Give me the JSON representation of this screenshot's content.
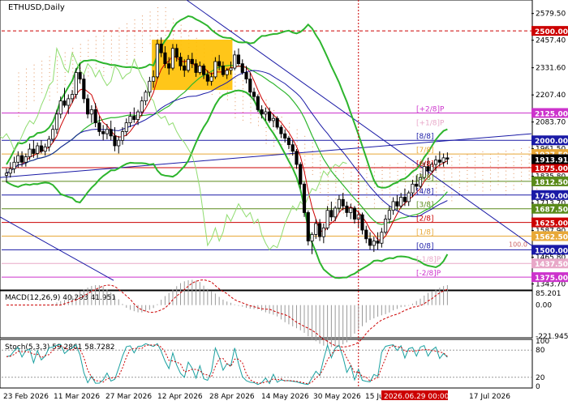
{
  "chart_data": {
    "type": "candlestick",
    "symbol": "ETHUSD",
    "timeframe": "Daily",
    "title": "ETHUSD,Daily",
    "y_ticks": [
      "2579.50",
      "2457.40",
      "2331.60",
      "2207.40",
      "2083.70",
      "1961.50",
      "1835.80",
      "1713.70",
      "1587.90",
      "1465.80",
      "1343.70"
    ],
    "x_ticks": [
      "23 Feb 2026",
      "11 Mar 2026",
      "27 Mar 2026",
      "12 Apr 2026",
      "28 Apr 2026",
      "14 May 2026",
      "30 May 2026",
      "15 Jun 2026",
      "2026.06.29 00:00",
      "17 Jul 2026"
    ],
    "cursor_label": "2026.06.29 00:00",
    "current_price": "1913.91",
    "hidden_price": "1937.50",
    "price_levels": [
      {
        "value": 2500.0,
        "label": "2500.00",
        "color": "#cc0000"
      },
      {
        "value": 2125.0,
        "label": "2125.00",
        "color": "#cc33cc"
      },
      {
        "value": 2000.0,
        "label": "2000.00",
        "color": "#1a1aa6"
      },
      {
        "value": 1937.5,
        "label": "1937.50",
        "color": "#e8a838"
      },
      {
        "value": 1875.0,
        "label": "1875.00",
        "color": "#cc0000"
      },
      {
        "value": 1812.5,
        "label": "1812.50",
        "color": "#5a8a1a"
      },
      {
        "value": 1750.0,
        "label": "1750.00",
        "color": "#1a1aa6"
      },
      {
        "value": 1687.5,
        "label": "1687.50",
        "color": "#5a8a1a"
      },
      {
        "value": 1625.0,
        "label": "1625.00",
        "color": "#cc0000"
      },
      {
        "value": 1562.5,
        "label": "1562.50",
        "color": "#e8a838"
      },
      {
        "value": 1500.0,
        "label": "1500.00",
        "color": "#1a1aa6"
      },
      {
        "value": 1437.5,
        "label": "1437.50",
        "color": "#e8a8c8"
      },
      {
        "value": 1375.0,
        "label": "1375.00",
        "color": "#cc33cc"
      }
    ],
    "murrey_labels": [
      {
        "text": "[+2/8]P",
        "value": 2125.0,
        "color": "#cc33cc"
      },
      {
        "text": "[+1/8]P",
        "value": 2062.5,
        "color": "#e8a8c8"
      },
      {
        "text": "[8/8]",
        "value": 2000.0,
        "color": "#1a1aa6"
      },
      {
        "text": "[7/8]",
        "value": 1937.5,
        "color": "#e8a838"
      },
      {
        "text": "[6/8]",
        "value": 1875.0,
        "color": "#cc0000"
      },
      {
        "text": "[5/8]",
        "value": 1812.5,
        "color": "#5a8a1a"
      },
      {
        "text": "[4/8]",
        "value": 1750.0,
        "color": "#1a1aa6"
      },
      {
        "text": "[3/8]",
        "value": 1687.5,
        "color": "#5a8a1a"
      },
      {
        "text": "[2/8]",
        "value": 1625.0,
        "color": "#cc0000"
      },
      {
        "text": "[1/8]",
        "value": 1562.5,
        "color": "#e8a838"
      },
      {
        "text": "[0/8]",
        "value": 1500.0,
        "color": "#1a1aa6"
      },
      {
        "text": "[-1/8]P",
        "value": 1437.5,
        "color": "#e8a8c8"
      },
      {
        "text": "[-2/8]P",
        "value": 1375.0,
        "color": "#cc33cc"
      }
    ],
    "percent_label": "100.0",
    "ohlc": [
      [
        1840,
        1872,
        1808,
        1850
      ],
      [
        1850,
        1900,
        1830,
        1870
      ],
      [
        1870,
        1925,
        1850,
        1900
      ],
      [
        1900,
        1950,
        1875,
        1930
      ],
      [
        1930,
        1950,
        1880,
        1900
      ],
      [
        1900,
        1940,
        1880,
        1925
      ],
      [
        1925,
        1985,
        1910,
        1960
      ],
      [
        1960,
        2000,
        1920,
        1940
      ],
      [
        1940,
        1990,
        1920,
        1975
      ],
      [
        1975,
        2000,
        1940,
        1950
      ],
      [
        1950,
        1985,
        1930,
        1970
      ],
      [
        1970,
        2020,
        1950,
        2005
      ],
      [
        2005,
        2070,
        1990,
        2050
      ],
      [
        2050,
        2140,
        2030,
        2120
      ],
      [
        2120,
        2200,
        2100,
        2180
      ],
      [
        2180,
        2240,
        2150,
        2160
      ],
      [
        2160,
        2210,
        2120,
        2190
      ],
      [
        2190,
        2230,
        2170,
        2210
      ],
      [
        2210,
        2330,
        2190,
        2310
      ],
      [
        2310,
        2350,
        2260,
        2280
      ],
      [
        2280,
        2300,
        2170,
        2190
      ],
      [
        2190,
        2210,
        2100,
        2120
      ],
      [
        2120,
        2160,
        2080,
        2140
      ],
      [
        2140,
        2170,
        2060,
        2080
      ],
      [
        2080,
        2110,
        2020,
        2040
      ],
      [
        2040,
        2070,
        2000,
        2030
      ],
      [
        2030,
        2075,
        2005,
        2050
      ],
      [
        2050,
        2090,
        2000,
        2020
      ],
      [
        2020,
        2060,
        1950,
        1975
      ],
      [
        1975,
        2020,
        1940,
        2000
      ],
      [
        2000,
        2060,
        1980,
        2040
      ],
      [
        2040,
        2100,
        2020,
        2080
      ],
      [
        2080,
        2130,
        2060,
        2110
      ],
      [
        2110,
        2150,
        2080,
        2095
      ],
      [
        2095,
        2140,
        2070,
        2130
      ],
      [
        2130,
        2200,
        2110,
        2180
      ],
      [
        2180,
        2230,
        2160,
        2220
      ],
      [
        2220,
        2290,
        2200,
        2270
      ],
      [
        2270,
        2320,
        2240,
        2290
      ],
      [
        2290,
        2460,
        2280,
        2440
      ],
      [
        2440,
        2470,
        2380,
        2400
      ],
      [
        2400,
        2430,
        2330,
        2350
      ],
      [
        2350,
        2380,
        2300,
        2330
      ],
      [
        2330,
        2440,
        2320,
        2420
      ],
      [
        2420,
        2440,
        2360,
        2380
      ],
      [
        2380,
        2400,
        2320,
        2340
      ],
      [
        2340,
        2370,
        2290,
        2320
      ],
      [
        2320,
        2390,
        2310,
        2370
      ],
      [
        2370,
        2400,
        2330,
        2350
      ],
      [
        2350,
        2370,
        2290,
        2310
      ],
      [
        2310,
        2360,
        2300,
        2340
      ],
      [
        2340,
        2350,
        2280,
        2300
      ],
      [
        2300,
        2320,
        2250,
        2270
      ],
      [
        2270,
        2310,
        2250,
        2290
      ],
      [
        2290,
        2380,
        2280,
        2360
      ],
      [
        2360,
        2390,
        2320,
        2340
      ],
      [
        2340,
        2360,
        2290,
        2300
      ],
      [
        2300,
        2330,
        2280,
        2320
      ],
      [
        2320,
        2360,
        2300,
        2330
      ],
      [
        2330,
        2410,
        2320,
        2390
      ],
      [
        2390,
        2420,
        2340,
        2350
      ],
      [
        2350,
        2370,
        2300,
        2310
      ],
      [
        2310,
        2340,
        2260,
        2280
      ],
      [
        2280,
        2310,
        2200,
        2220
      ],
      [
        2220,
        2240,
        2180,
        2200
      ],
      [
        2200,
        2210,
        2130,
        2140
      ],
      [
        2140,
        2160,
        2100,
        2120
      ],
      [
        2120,
        2150,
        2090,
        2130
      ],
      [
        2130,
        2150,
        2080,
        2090
      ],
      [
        2090,
        2120,
        2060,
        2100
      ],
      [
        2100,
        2110,
        2050,
        2060
      ],
      [
        2060,
        2070,
        2010,
        2030
      ],
      [
        2030,
        2050,
        1990,
        2010
      ],
      [
        2010,
        2020,
        1960,
        1980
      ],
      [
        1980,
        2000,
        1930,
        1950
      ],
      [
        1950,
        1960,
        1870,
        1890
      ],
      [
        1890,
        1900,
        1780,
        1800
      ],
      [
        1800,
        1810,
        1650,
        1670
      ],
      [
        1670,
        1680,
        1520,
        1540
      ],
      [
        1540,
        1580,
        1480,
        1570
      ],
      [
        1570,
        1640,
        1550,
        1620
      ],
      [
        1620,
        1640,
        1540,
        1560
      ],
      [
        1560,
        1620,
        1530,
        1600
      ],
      [
        1600,
        1700,
        1590,
        1680
      ],
      [
        1680,
        1720,
        1630,
        1650
      ],
      [
        1650,
        1700,
        1630,
        1690
      ],
      [
        1690,
        1750,
        1670,
        1730
      ],
      [
        1730,
        1760,
        1680,
        1700
      ],
      [
        1700,
        1720,
        1650,
        1670
      ],
      [
        1670,
        1710,
        1640,
        1690
      ],
      [
        1690,
        1700,
        1620,
        1640
      ],
      [
        1640,
        1680,
        1600,
        1660
      ],
      [
        1660,
        1670,
        1570,
        1590
      ],
      [
        1590,
        1610,
        1530,
        1550
      ],
      [
        1550,
        1580,
        1500,
        1520
      ],
      [
        1520,
        1560,
        1490,
        1540
      ],
      [
        1540,
        1580,
        1500,
        1530
      ],
      [
        1530,
        1600,
        1510,
        1580
      ],
      [
        1580,
        1660,
        1570,
        1640
      ],
      [
        1640,
        1700,
        1620,
        1680
      ],
      [
        1680,
        1740,
        1660,
        1720
      ],
      [
        1720,
        1750,
        1680,
        1700
      ],
      [
        1700,
        1760,
        1690,
        1740
      ],
      [
        1740,
        1780,
        1700,
        1720
      ],
      [
        1720,
        1770,
        1700,
        1760
      ],
      [
        1760,
        1820,
        1740,
        1800
      ],
      [
        1800,
        1840,
        1770,
        1790
      ],
      [
        1790,
        1850,
        1780,
        1830
      ],
      [
        1830,
        1900,
        1820,
        1880
      ],
      [
        1880,
        1920,
        1840,
        1860
      ],
      [
        1860,
        1900,
        1850,
        1890
      ],
      [
        1890,
        1930,
        1860,
        1910
      ],
      [
        1910,
        1950,
        1880,
        1900
      ],
      [
        1900,
        1940,
        1880,
        1920
      ],
      [
        1920,
        1945,
        1890,
        1914
      ]
    ],
    "macd": {
      "label": "MACD(12,26,9) 40.293 41.951",
      "params": "12,26,9",
      "main": 40.293,
      "signal": 41.951,
      "y_ticks": [
        "85.201",
        "0.00",
        "-221.945"
      ]
    },
    "stochastic": {
      "label": "Stoch(5,3,3) 59.2861 58.7282",
      "params": "5,3,3",
      "k": 59.2861,
      "d": 58.7282,
      "y_ticks": [
        "100",
        "80",
        "20",
        "0"
      ]
    },
    "colors": {
      "bull": "#1a8a1a",
      "bear": "#cc0000",
      "bollinger": "#2db52d",
      "ma_fast": "#cc0000",
      "ma_slow": "#1a1aa6",
      "ichimoku_cloud": "#e6a070",
      "cursor": "#cc0000",
      "highlight_box": "#ffc000",
      "stoch_main": "#1aa0a0",
      "stoch_signal": "#cc0000"
    }
  }
}
